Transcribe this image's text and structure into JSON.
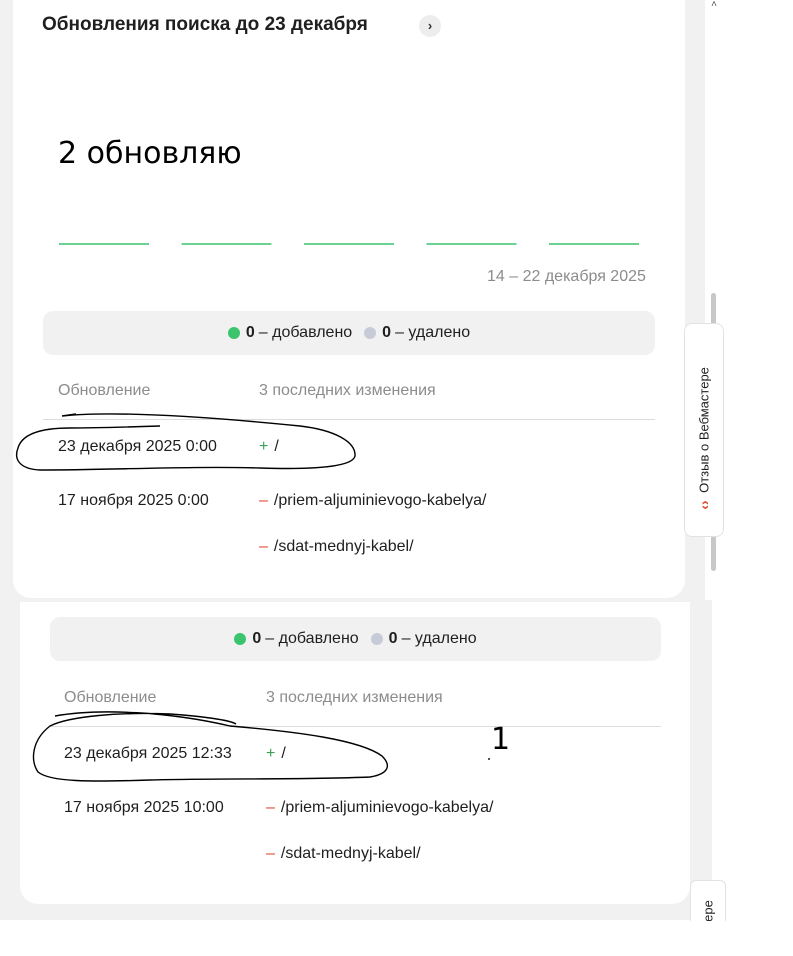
{
  "header": {
    "title": "Обновления поиска до 23 декабря",
    "chevron": "›"
  },
  "annotations": {
    "top_note": "2 обновляю",
    "bottom_note": "1"
  },
  "chart_data": {
    "type": "line",
    "segments": 5,
    "values": [
      0,
      0,
      0,
      0,
      0
    ],
    "color": "#3cc46d",
    "date_range": "14 – 22 декабря 2025"
  },
  "panel_top": {
    "summary": {
      "added_count": "0",
      "added_label": "– добавлено",
      "removed_count": "0",
      "removed_label": "– удалено"
    },
    "columns": {
      "update": "Обновление",
      "changes": "3 последних изменения"
    },
    "rows": [
      {
        "date": "23 декабря 2025 0:00",
        "changes": [
          {
            "sign": "+",
            "path": "/"
          }
        ]
      },
      {
        "date": "17 ноября 2025 0:00",
        "changes": [
          {
            "sign": "–",
            "path": "/priem-aljuminievogo-kabelya/"
          },
          {
            "sign": "–",
            "path": "/sdat-mednyj-kabel/"
          }
        ]
      }
    ]
  },
  "panel_bottom": {
    "summary": {
      "added_count": "0",
      "added_label": "– добавлено",
      "removed_count": "0",
      "removed_label": "– удалено"
    },
    "columns": {
      "update": "Обновление",
      "changes": "3 последних изменения"
    },
    "rows": [
      {
        "date": "23 декабря 2025 12:33",
        "changes": [
          {
            "sign": "+",
            "path": "/"
          }
        ]
      },
      {
        "date": "17 ноября 2025 10:00",
        "changes": [
          {
            "sign": "–",
            "path": "/priem-aljuminievogo-kabelya/"
          },
          {
            "sign": "–",
            "path": "/sdat-mednyj-kabel/"
          }
        ]
      }
    ]
  },
  "feedback": {
    "label": "Отзыв о Вебмастере",
    "label_partial": "ере",
    "icon": "wrench-code-icon"
  },
  "scrollbar": {
    "up_arrow": "˄"
  },
  "colors": {
    "green": "#3cc46d",
    "gray_dot": "#c7cbd8",
    "plus": "#3aa05a",
    "minus": "#e0462c",
    "muted": "#8c8c8c"
  }
}
